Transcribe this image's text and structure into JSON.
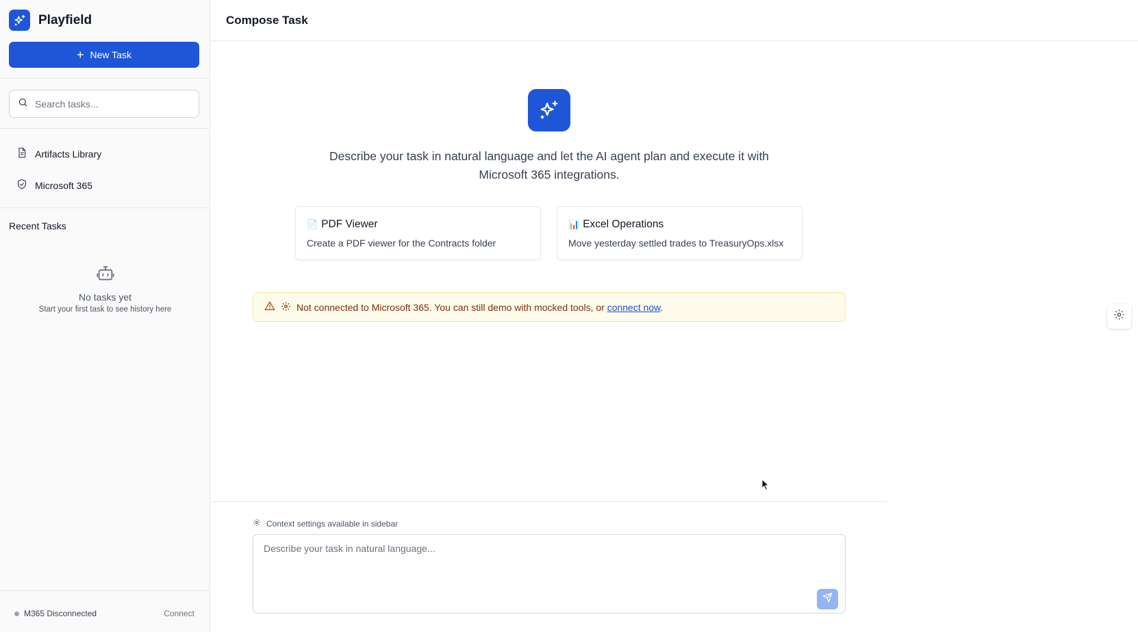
{
  "sidebar": {
    "brand": "Playfield",
    "new_task_label": "New Task",
    "search_placeholder": "Search tasks...",
    "nav": [
      {
        "label": "Artifacts Library",
        "icon": "document-icon"
      },
      {
        "label": "Microsoft 365",
        "icon": "shield-icon"
      }
    ],
    "recent_title": "Recent Tasks",
    "empty_title": "No tasks yet",
    "empty_sub": "Start your first task to see history here",
    "status_label": "M365 Disconnected",
    "connect_label": "Connect"
  },
  "header": {
    "title": "Compose Task"
  },
  "hero": {
    "text": "Describe your task in natural language and let the AI agent plan and execute it with Microsoft 365 integrations."
  },
  "cards": [
    {
      "icon": "📄",
      "title": "PDF Viewer",
      "desc": "Create a PDF viewer for the Contracts folder"
    },
    {
      "icon": "📊",
      "title": "Excel Operations",
      "desc": "Move yesterday settled trades to TreasuryOps.xlsx"
    }
  ],
  "warning": {
    "text": "Not connected to Microsoft 365. You can still demo with mocked tools, or ",
    "link": "connect now",
    "suffix": "."
  },
  "composer": {
    "context_note": "Context settings available in sidebar",
    "placeholder": "Describe your task in natural language..."
  },
  "colors": {
    "accent": "#1f56d8",
    "warning_bg": "#fefbeb",
    "warning_border": "#fde68a"
  }
}
